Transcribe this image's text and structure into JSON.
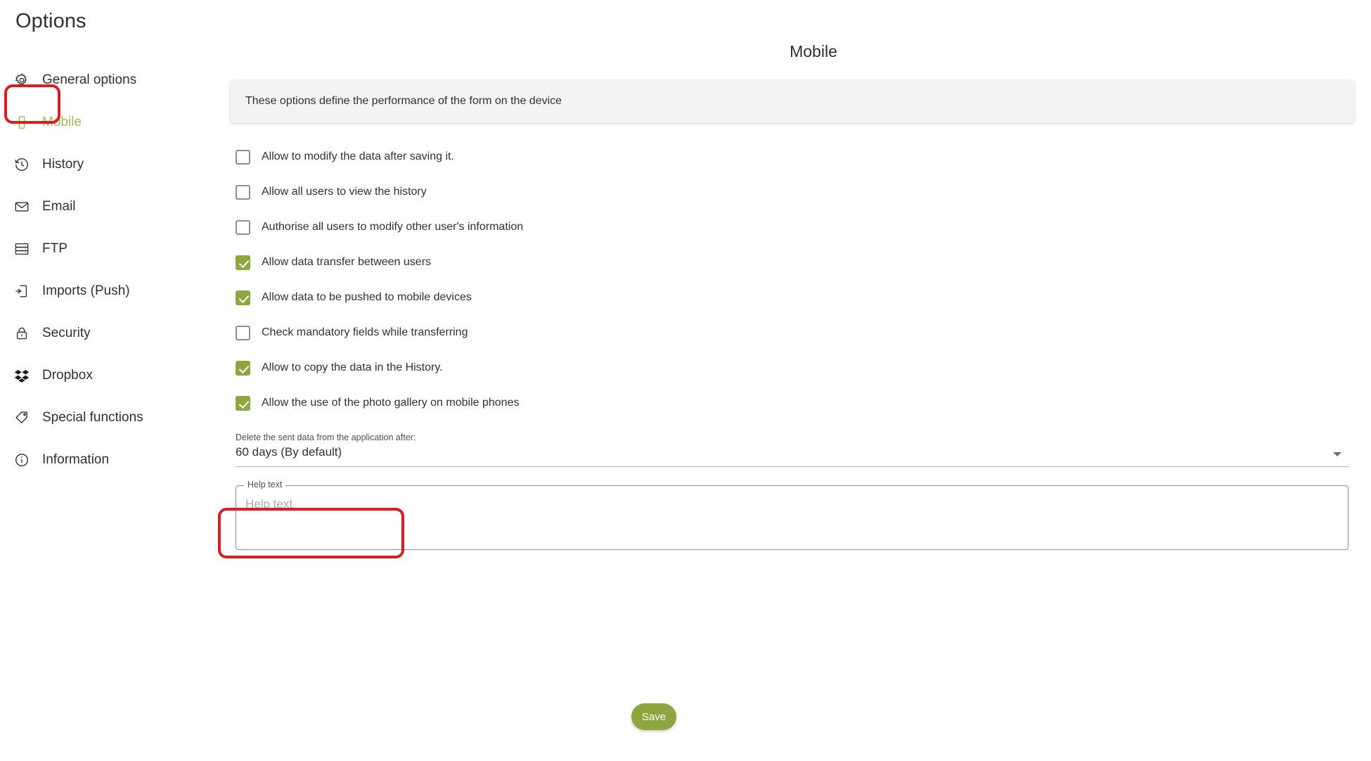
{
  "page": {
    "title": "Options"
  },
  "sidebar": {
    "items": [
      {
        "label": "General options",
        "icon": "gear-icon",
        "active": false
      },
      {
        "label": "Mobile",
        "icon": "mobile-phone-icon",
        "active": true
      },
      {
        "label": "History",
        "icon": "history-clock-icon",
        "active": false
      },
      {
        "label": "Email",
        "icon": "envelope-icon",
        "active": false
      },
      {
        "label": "FTP",
        "icon": "server-icon",
        "active": false
      },
      {
        "label": "Imports (Push)",
        "icon": "import-arrow-icon",
        "active": false
      },
      {
        "label": "Security",
        "icon": "lock-icon",
        "active": false
      },
      {
        "label": "Dropbox",
        "icon": "dropbox-icon",
        "active": false
      },
      {
        "label": "Special functions",
        "icon": "tag-icon",
        "active": false
      },
      {
        "label": "Information",
        "icon": "info-circle-icon",
        "active": false
      }
    ]
  },
  "main": {
    "section_title": "Mobile",
    "info_text": "These options define the performance of the form on the device",
    "checkboxes": [
      {
        "label": "Allow to modify the data after saving it.",
        "checked": false
      },
      {
        "label": "Allow all users to view the history",
        "checked": false
      },
      {
        "label": "Authorise all users to modify other user's information",
        "checked": false
      },
      {
        "label": "Allow data transfer between users",
        "checked": true
      },
      {
        "label": "Allow data to be pushed to mobile devices",
        "checked": true
      },
      {
        "label": "Check mandatory fields while transferring",
        "checked": false
      },
      {
        "label": "Allow to copy the data in the History.",
        "checked": true
      },
      {
        "label": "Allow the use of the photo gallery on mobile phones",
        "checked": true
      }
    ],
    "delete_after": {
      "label": "Delete the sent data from the application after:",
      "value": "60 days (By default)",
      "arrow_icon": "chevron-down-icon"
    },
    "help_text": {
      "legend": "Help text",
      "placeholder": "Help text",
      "value": ""
    },
    "save_label": "Save"
  },
  "colors": {
    "accent_green": "#8da63f",
    "active_nav": "#a7b55c",
    "annotation_red": "#d61f23",
    "panel_bg": "#f3f3f3"
  }
}
